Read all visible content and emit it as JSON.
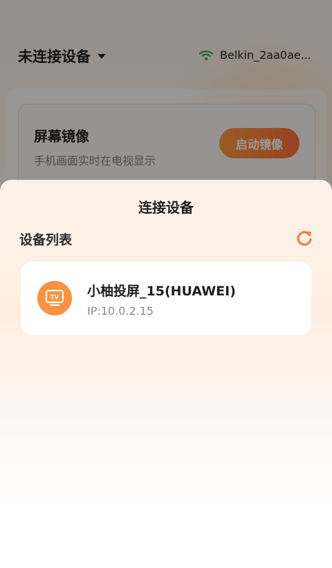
{
  "header": {
    "device_status": "未连接设备",
    "wifi_name": "Belkin_2aa0ae..."
  },
  "mirror_card": {
    "title": "屏幕镜像",
    "subtitle": "手机画面实时在电视显示",
    "button_label": "启动镜像"
  },
  "sheet": {
    "title": "连接设备",
    "list_label": "设备列表",
    "devices": [
      {
        "name": "小柚投屏_15(HUAWEI)",
        "ip": "IP:10.0.2.15",
        "icon": "tv-icon",
        "icon_text": "TV"
      }
    ]
  },
  "colors": {
    "accent": "#ff7a35",
    "wifi": "#2bb34a",
    "tv_icon_bg": "#fb9141"
  }
}
